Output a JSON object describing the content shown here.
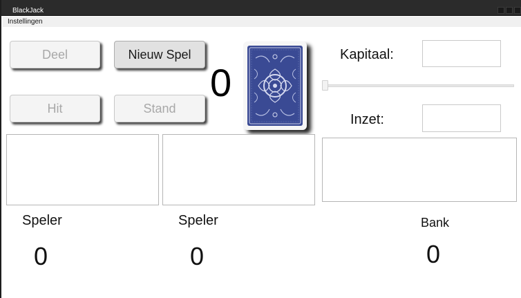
{
  "window": {
    "title": "BlackJack"
  },
  "menu": {
    "items": [
      "Instellingen"
    ]
  },
  "buttons": {
    "deal": "Deel",
    "new_game": "Nieuw Spel",
    "hit": "Hit",
    "stand": "Stand"
  },
  "deck": {
    "count": "0"
  },
  "capital": {
    "label": "Kapitaal:",
    "value": ""
  },
  "bet": {
    "label": "Inzet:",
    "value": ""
  },
  "hands": {
    "player1": {
      "label": "Speler",
      "score": "0"
    },
    "player2": {
      "label": "Speler",
      "score": "0"
    },
    "bank": {
      "label": "Bank",
      "score": "0"
    }
  },
  "colors": {
    "card_back": "#3a4a94",
    "titlebar": "#2b2b2b"
  }
}
